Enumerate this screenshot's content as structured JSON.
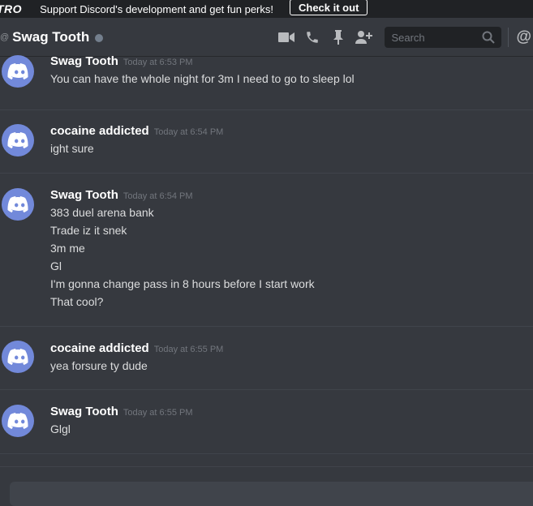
{
  "promo": {
    "brand": "TRO",
    "message": "Support Discord's development and get fun perks!",
    "button_label": "Check it out"
  },
  "header": {
    "at_symbol": "@",
    "title": "Swag Tooth",
    "search_placeholder": "Search",
    "icons": [
      "video-call-icon",
      "voice-call-icon",
      "pin-icon",
      "add-friend-icon",
      "search-icon",
      "mention-icon"
    ],
    "mention_symbol": "@"
  },
  "messages": [
    {
      "user": "Swag Tooth",
      "time": "Today at 6:53 PM",
      "lines": [
        "You can have the whole night for 3m I need to go to sleep lol"
      ]
    },
    {
      "user": "cocaine addicted",
      "time": "Today at 6:54 PM",
      "lines": [
        "ight sure"
      ]
    },
    {
      "user": "Swag Tooth",
      "time": "Today at 6:54 PM",
      "lines": [
        "383 duel arena bank",
        "Trade iz it snek",
        "3m me",
        "Gl",
        "I'm gonna change pass in 8 hours before I start work",
        "That cool?"
      ]
    },
    {
      "user": "cocaine addicted",
      "time": "Today at 6:55 PM",
      "lines": [
        "yea forsure ty dude"
      ]
    },
    {
      "user": "Swag Tooth",
      "time": "Today at 6:55 PM",
      "lines": [
        "Glgl"
      ]
    }
  ],
  "colors": {
    "background": "#36393f",
    "avatar": "#7289da",
    "timestamp": "#72767d",
    "status_offline": "#747f8d"
  }
}
